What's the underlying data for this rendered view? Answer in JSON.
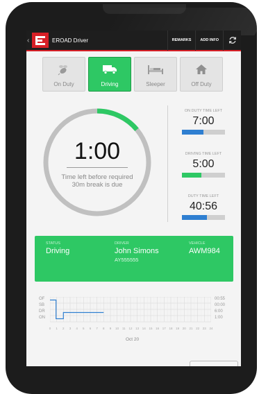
{
  "app": {
    "title": "EROAD Driver"
  },
  "header": {
    "remarks_label": "REMARKS",
    "add_info_label": "ADD INFO"
  },
  "status_buttons": [
    {
      "label": "On Duty",
      "icon": "bee-icon",
      "active": false
    },
    {
      "label": "Driving",
      "icon": "truck-icon",
      "active": true
    },
    {
      "label": "Sleeper",
      "icon": "bed-icon",
      "active": false
    },
    {
      "label": "Off Duty",
      "icon": "house-icon",
      "active": false
    }
  ],
  "dial": {
    "time": "1:00",
    "caption_line1": "Time left before required",
    "caption_line2": "30m break is due",
    "progress_fraction": 0.14
  },
  "timers": [
    {
      "label": "ON DUTY TIME LEFT",
      "value": "7:00",
      "fill_fraction": 0.5,
      "color": "#2f7fd1"
    },
    {
      "label": "DRIVING TIME LEFT",
      "value": "5:00",
      "fill_fraction": 0.45,
      "color": "#2ec864"
    },
    {
      "label": "DUTY TIME LEFT",
      "value": "40:56",
      "fill_fraction": 0.58,
      "color": "#2f7fd1"
    }
  ],
  "status_card": {
    "status_label": "STATUS",
    "status_value": "Driving",
    "driver_label": "DRIVER",
    "driver_name": "John Simons",
    "driver_id": "AY555555",
    "vehicle_label": "VEHICLE",
    "vehicle_value": "AWM984"
  },
  "graph": {
    "rows": [
      "OF",
      "SB",
      "DR",
      "ON"
    ],
    "totals": [
      "00:55",
      "00:00",
      "6:00",
      "1:00"
    ],
    "hours": [
      "0",
      "1",
      "2",
      "3",
      "4",
      "5",
      "6",
      "7",
      "8",
      "9",
      "10",
      "11",
      "12",
      "13",
      "14",
      "15",
      "16",
      "17",
      "18",
      "19",
      "20",
      "21",
      "22",
      "23",
      "24"
    ],
    "date": "Oct 20",
    "log_segments": [
      {
        "row": "OF",
        "from": 0,
        "to": 0.9
      },
      {
        "row": "ON",
        "from": 0.9,
        "to": 2
      },
      {
        "row": "DR",
        "from": 2,
        "to": 8
      }
    ]
  },
  "colors": {
    "accent_green": "#2ec864",
    "brand_red": "#d71f26",
    "log_line": "#2f7fd1"
  }
}
